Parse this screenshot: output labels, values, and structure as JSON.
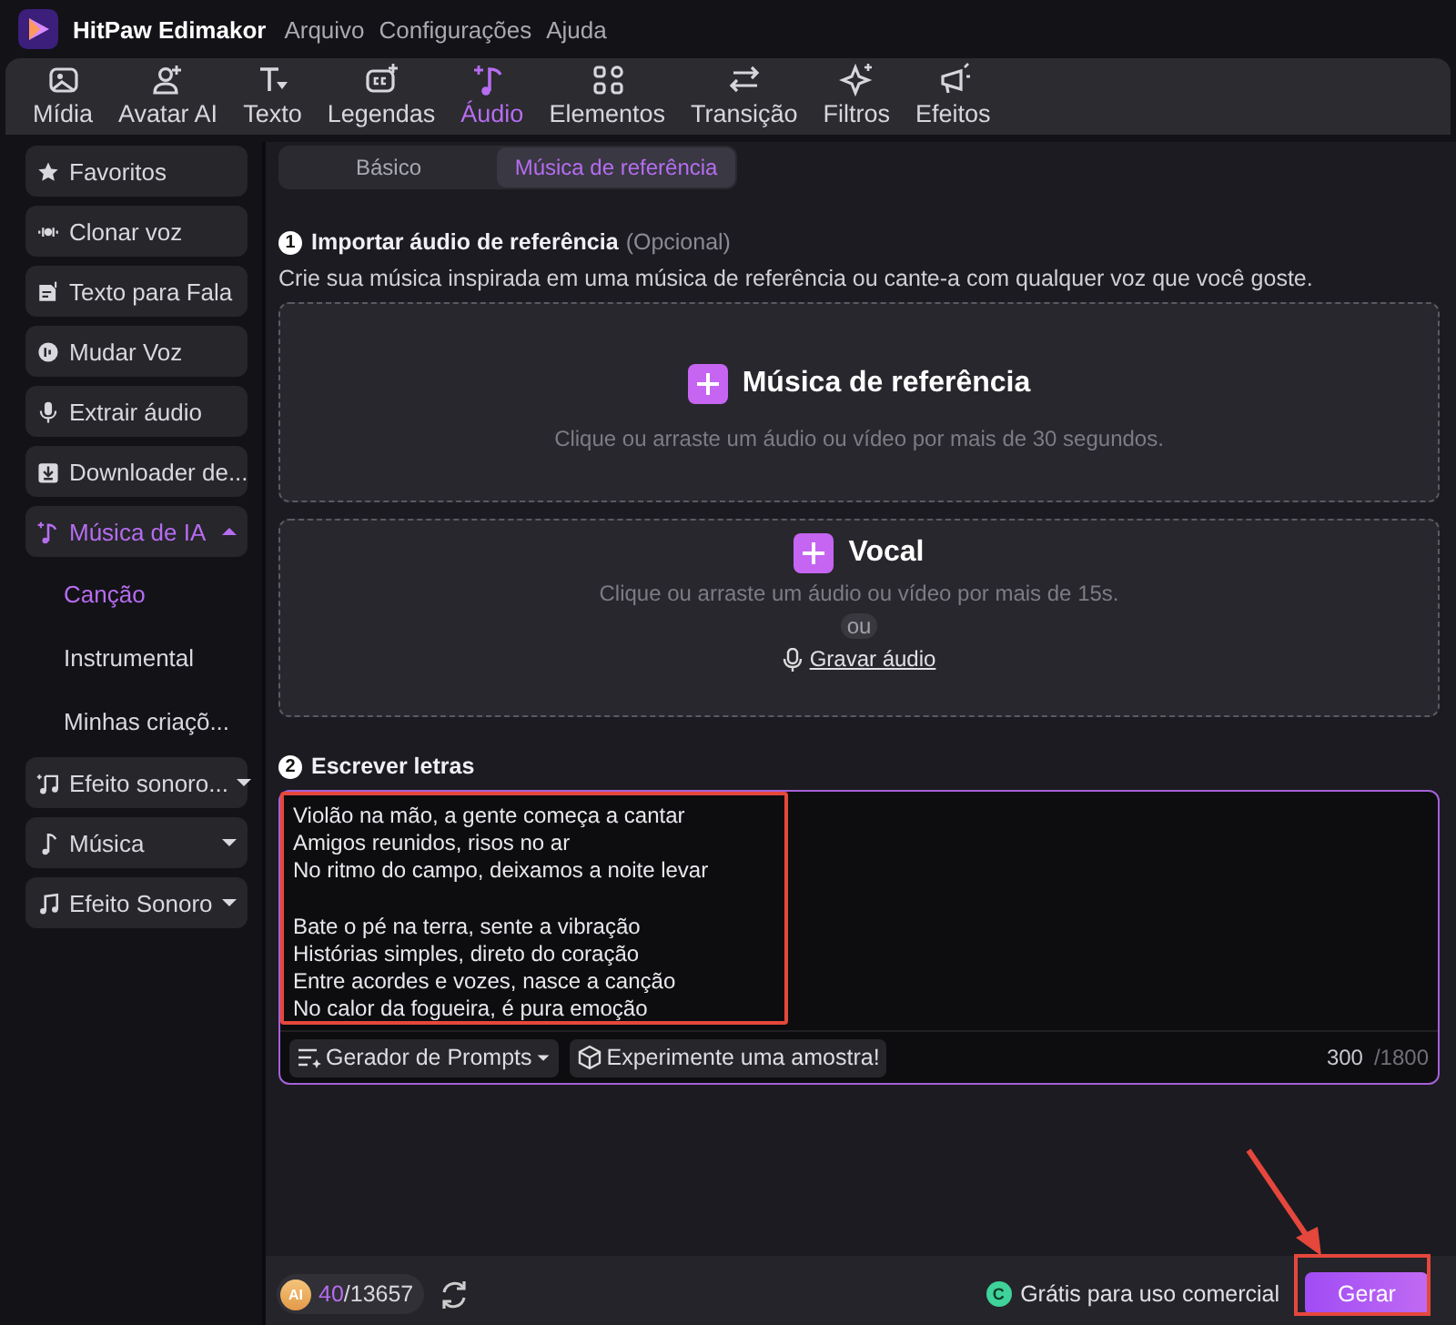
{
  "app": {
    "name": "HitPaw Edimakor"
  },
  "menu": [
    "Arquivo",
    "Configurações",
    "Ajuda"
  ],
  "toolbar": [
    {
      "label": "Mídia",
      "selected": false
    },
    {
      "label": "Avatar AI",
      "selected": false
    },
    {
      "label": "Texto",
      "selected": false
    },
    {
      "label": "Legendas",
      "selected": false
    },
    {
      "label": "Áudio",
      "selected": true
    },
    {
      "label": "Elementos",
      "selected": false
    },
    {
      "label": "Transição",
      "selected": false
    },
    {
      "label": "Filtros",
      "selected": false
    },
    {
      "label": "Efeitos",
      "selected": false
    }
  ],
  "sidebar": {
    "items": [
      {
        "label": "Favoritos",
        "kind": "item",
        "selected": false
      },
      {
        "label": "Clonar voz",
        "kind": "item",
        "selected": false
      },
      {
        "label": "Texto para Fala",
        "kind": "item",
        "selected": false
      },
      {
        "label": "Mudar Voz",
        "kind": "item",
        "selected": false
      },
      {
        "label": "Extrair áudio",
        "kind": "item",
        "selected": false
      },
      {
        "label": "Downloader de...",
        "kind": "item",
        "selected": false
      },
      {
        "label": "Música de IA",
        "kind": "group",
        "selected": true,
        "expanded": true,
        "children": [
          {
            "label": "Canção",
            "selected": true
          },
          {
            "label": "Instrumental",
            "selected": false
          },
          {
            "label": "Minhas criaçõ...",
            "selected": false
          }
        ]
      },
      {
        "label": "Efeito sonoro...",
        "kind": "group",
        "selected": false,
        "expanded": false
      },
      {
        "label": "Música",
        "kind": "group",
        "selected": false,
        "expanded": false
      },
      {
        "label": "Efeito Sonoro",
        "kind": "group",
        "selected": false,
        "expanded": false
      }
    ]
  },
  "mode_tabs": [
    {
      "label": "Básico",
      "selected": false
    },
    {
      "label": "Música de referência",
      "selected": true
    }
  ],
  "step1": {
    "number": "1",
    "title": "Importar áudio de referência",
    "note": "(Opcional)",
    "description": "Crie sua música inspirada em uma música de referência ou cante-a com qualquer voz que você goste."
  },
  "reference_drop": {
    "title": "Música de referência",
    "hint": "Clique ou arraste um áudio ou vídeo por mais de 30 segundos."
  },
  "vocal_drop": {
    "title": "Vocal",
    "hint": "Clique ou arraste um áudio ou vídeo por mais de 15s.",
    "separator": "ou",
    "record_link": "Gravar áudio"
  },
  "step2": {
    "number": "2",
    "title": "Escrever letras"
  },
  "lyrics": {
    "value": "Violão na mão, a gente começa a cantar\nAmigos reunidos, risos no ar\nNo ritmo do campo, deixamos a noite levar\n\nBate o pé na terra, sente a vibração\nHistórias simples, direto do coração\nEntre acordes e vozes, nasce a canção\nNo calor da fogueira, é pura emoção",
    "prompt_button": "Gerador de Prompts",
    "sample_button": "Experimente uma amostra!",
    "count": "300",
    "max": "/1800"
  },
  "footer": {
    "coin_label": "AI",
    "credits_used": "40",
    "credits_total": "/13657",
    "license": "Grátis para uso comercial",
    "license_badge": "C",
    "generate": "Gerar"
  }
}
